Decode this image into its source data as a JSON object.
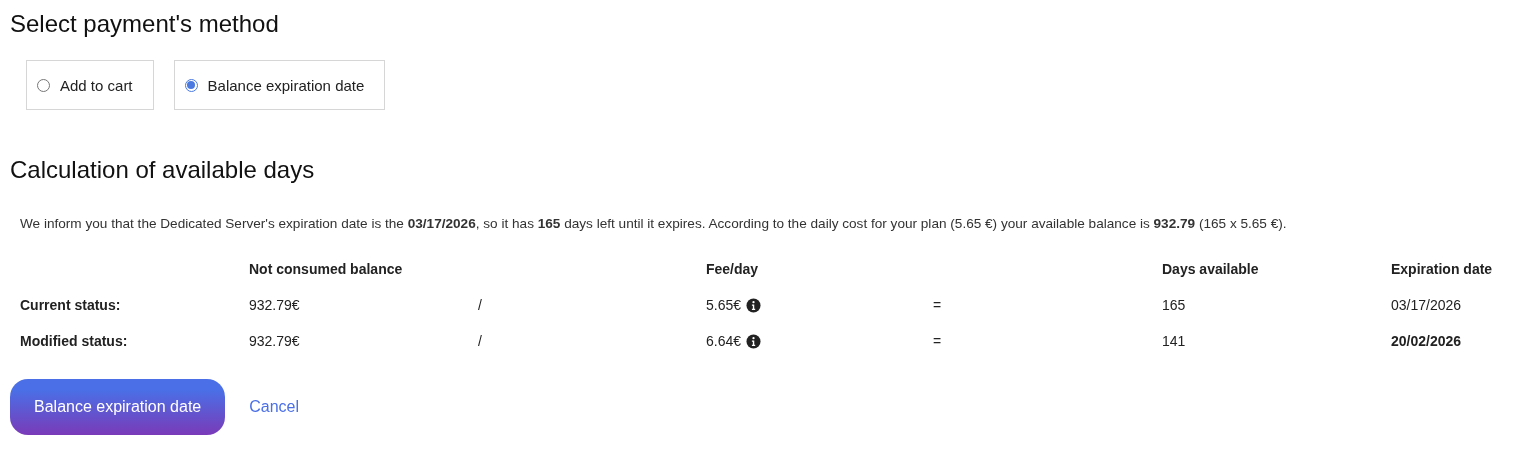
{
  "payment_section": {
    "title": "Select payment's method",
    "options": [
      {
        "label": "Add to cart",
        "selected": false
      },
      {
        "label": "Balance expiration date",
        "selected": true
      }
    ]
  },
  "calculation_section": {
    "title": "Calculation of available days",
    "info_text": "We inform you that the Dedicated Server's expiration date is the **03/17/2026**, so it has **165** days left until it expires. According to the daily cost for your plan (5.65 €) your available balance is **932.79** (165 x 5.65 €).",
    "table": {
      "columns": [
        "Not consumed balance",
        "Fee/day",
        "Days available",
        "Expiration date"
      ],
      "rows": [
        {
          "label": "Current status:",
          "balance": "932.79€",
          "divide": "/",
          "fee": "5.65€",
          "equals": "=",
          "days": "165",
          "expiration": "03/17/2026",
          "highlighted": false
        },
        {
          "label": "Modified status:",
          "balance": "932.79€",
          "divide": "/",
          "fee": "6.64€",
          "equals": "=",
          "days": "141",
          "expiration": "20/02/2026",
          "highlighted": true
        }
      ]
    }
  },
  "actions": {
    "primary_button": "Balance expiration date",
    "cancel_link": "Cancel"
  }
}
